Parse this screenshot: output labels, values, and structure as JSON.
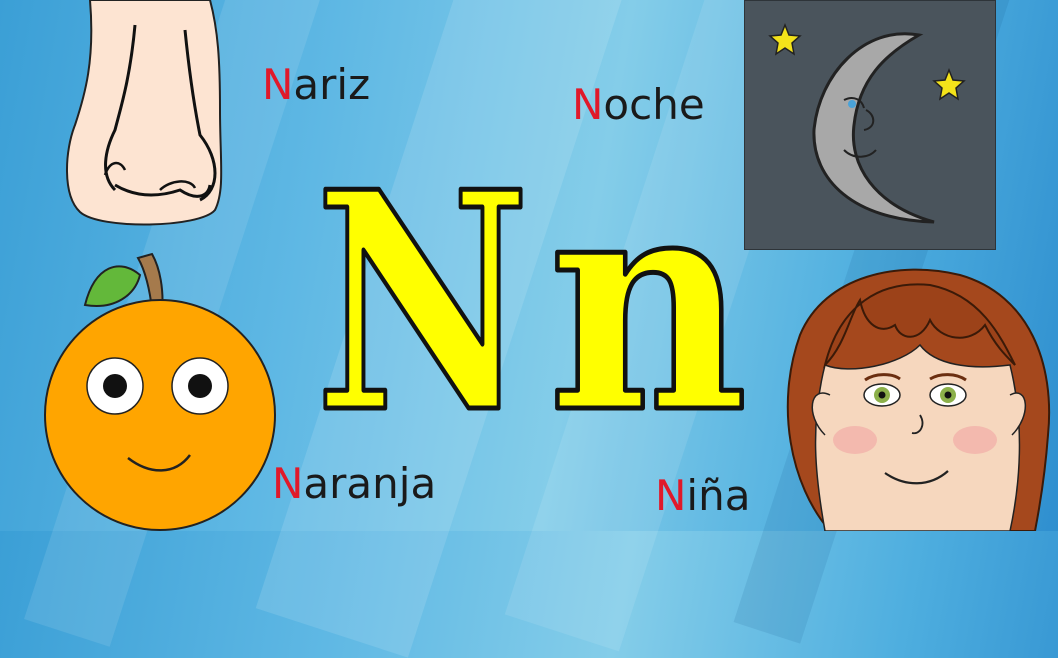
{
  "letters": {
    "upper": "N",
    "lower": "n"
  },
  "words": {
    "nariz": {
      "initial": "N",
      "rest": "ariz"
    },
    "noche": {
      "initial": "N",
      "rest": "oche"
    },
    "naranja": {
      "initial": "N",
      "rest": "aranja"
    },
    "nina": {
      "initial": "N",
      "rest": "iña"
    }
  },
  "colors": {
    "letter_fill": "#ffff00",
    "letter_outline": "#111111",
    "initial": "#e0192a",
    "night_sky": "#4a545c",
    "orange": "#ffa500"
  },
  "icons": [
    "nose-icon",
    "moon-icon",
    "star-icon",
    "orange-icon",
    "girl-icon"
  ]
}
